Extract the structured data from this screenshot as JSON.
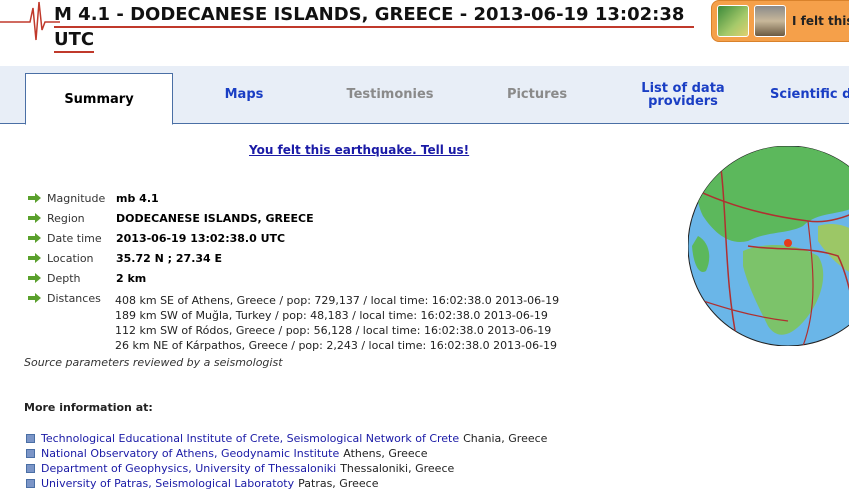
{
  "header": {
    "title_line1": "M 4.1 - DODECANESE ISLANDS, GREECE - 2013-06-19 13:02:38",
    "title_line2": "UTC",
    "felt_button_label": "I felt this"
  },
  "tabs": [
    {
      "label": "Summary",
      "state": "active"
    },
    {
      "label": "Maps",
      "state": "link"
    },
    {
      "label": "Testimonies",
      "state": "disabled"
    },
    {
      "label": "Pictures",
      "state": "disabled"
    },
    {
      "label": "List of data providers",
      "state": "link"
    },
    {
      "label": "Scientific d",
      "state": "link"
    }
  ],
  "felt_link": "You felt this earthquake. Tell us!",
  "details": {
    "magnitude": {
      "label": "Magnitude",
      "value": "mb 4.1"
    },
    "region": {
      "label": "Region",
      "value": "DODECANESE ISLANDS, GREECE"
    },
    "date_time": {
      "label": "Date time",
      "value": "2013-06-19 13:02:38.0 UTC"
    },
    "location": {
      "label": "Location",
      "value": "35.72 N ; 27.34 E"
    },
    "depth": {
      "label": "Depth",
      "value": "2 km"
    },
    "distances_label": "Distances",
    "distances": [
      "408 km SE of Athens, Greece / pop: 729,137 / local time: 16:02:38.0 2013-06-19",
      "189 km SW of Muğla, Turkey / pop: 48,183 / local time: 16:02:38.0 2013-06-19",
      "112 km SW of Ródos, Greece / pop: 56,128 / local time: 16:02:38.0 2013-06-19",
      "26 km NE of Kárpathos, Greece / pop: 2,243 / local time: 16:02:38.0 2013-06-19"
    ]
  },
  "reviewed_note": "Source parameters reviewed by a seismologist",
  "more_info": {
    "heading": "More information at:",
    "items": [
      {
        "link": "Technological Educational Institute of Crete, Seismological Network of Crete",
        "location": "Chania, Greece"
      },
      {
        "link": "National Observatory of Athens, Geodynamic Institute",
        "location": "Athens, Greece"
      },
      {
        "link": "Department of Geophysics, University of Thessaloniki",
        "location": "Thessaloniki, Greece"
      },
      {
        "link": "University of Patras, Seismological Laboratoty",
        "location": "Patras, Greece"
      }
    ]
  },
  "colors": {
    "accent_red": "#c0392b",
    "link_blue": "#1a1aa6",
    "tab_border": "#4a6fa5",
    "arrow_green": "#5aa02c"
  }
}
